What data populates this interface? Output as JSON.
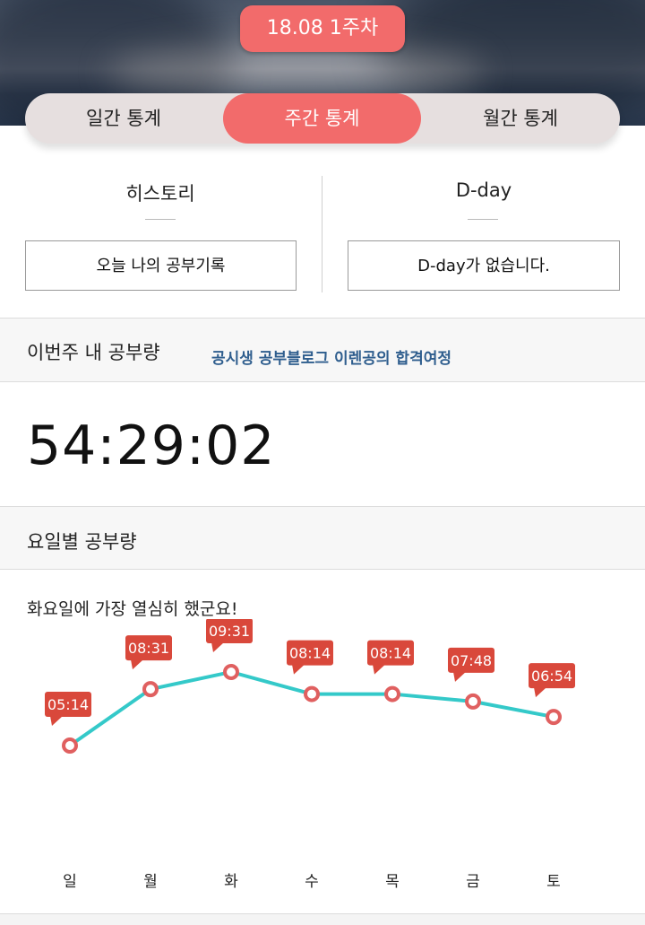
{
  "header": {
    "week_label": "18.08 1주차"
  },
  "tabs": [
    {
      "label": "일간 통계",
      "active": false
    },
    {
      "label": "주간 통계",
      "active": true
    },
    {
      "label": "월간 통계",
      "active": false
    }
  ],
  "history": {
    "title": "히스토리",
    "button": "오늘 나의 공부기록"
  },
  "dday": {
    "title": "D-day",
    "button": "D-day가 없습니다."
  },
  "weekly": {
    "label": "이번주 내 공부량",
    "promo": "공시생 공부블로그 이렌공의 합격여정",
    "total": "54:29:02"
  },
  "daily": {
    "label": "요일별 공부량",
    "caption": "화요일에 가장 열심히 했군요!"
  },
  "colors": {
    "accent": "#f26b6b",
    "line": "#34c9c9",
    "marker": "#e06060",
    "callout": "#d9483b"
  },
  "chart_data": {
    "type": "line",
    "categories": [
      "일",
      "월",
      "화",
      "수",
      "목",
      "금",
      "토"
    ],
    "labels": [
      "05:14",
      "08:31",
      "09:31",
      "08:14",
      "08:14",
      "07:48",
      "06:54"
    ],
    "values_minutes": [
      314,
      511,
      571,
      494,
      494,
      468,
      414
    ]
  }
}
